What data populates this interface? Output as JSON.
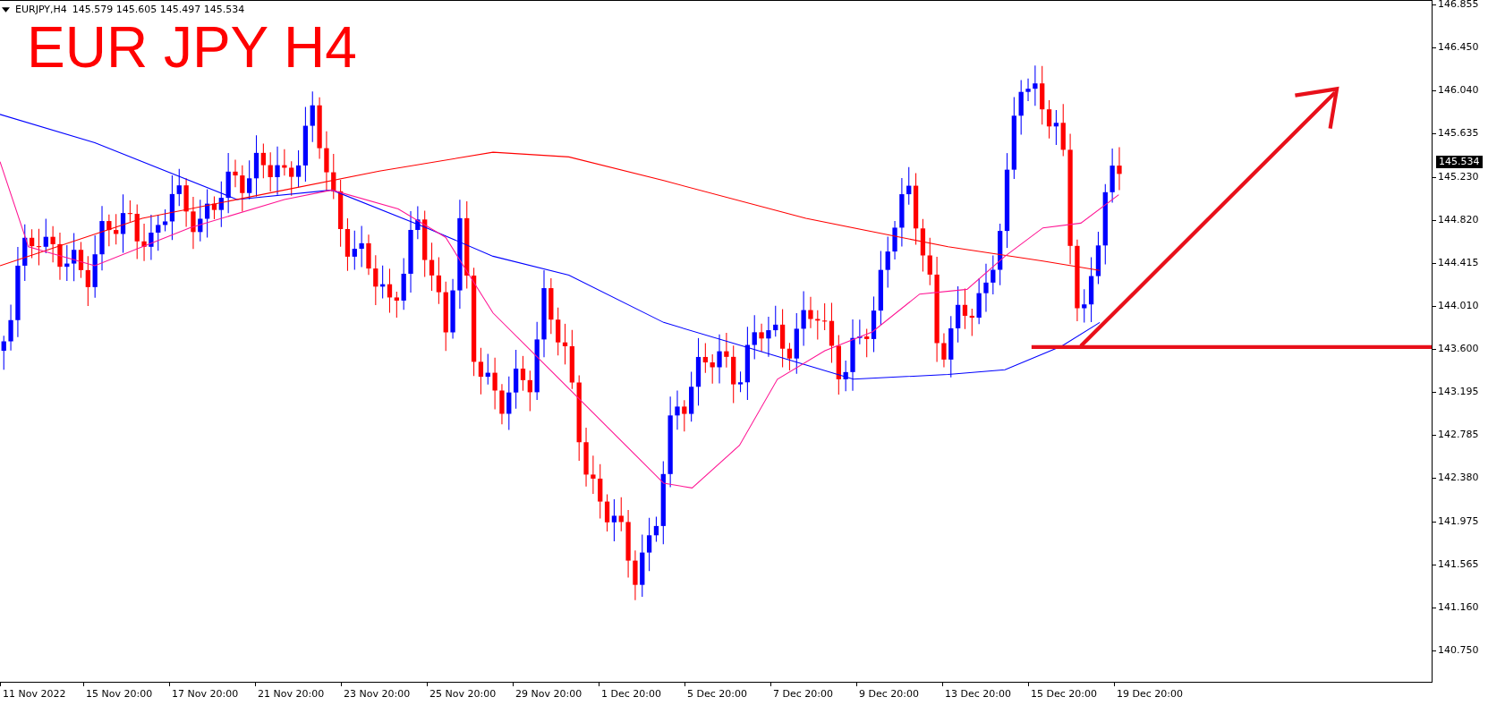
{
  "header": {
    "symbol": "EURJPY,H4",
    "ohlc": "145.579 145.605 145.497 145.534"
  },
  "title": "EUR JPY H4",
  "price_axis": [
    "146.855",
    "146.450",
    "146.040",
    "145.635",
    "145.230",
    "144.820",
    "144.415",
    "144.010",
    "143.600",
    "143.195",
    "142.785",
    "142.380",
    "141.975",
    "141.565",
    "141.160",
    "140.750"
  ],
  "current_price": "145.534",
  "time_axis": [
    "11 Nov 2022",
    "15 Nov 20:00",
    "17 Nov 20:00",
    "21 Nov 20:00",
    "23 Nov 20:00",
    "25 Nov 20:00",
    "29 Nov 20:00",
    "1 Dec 20:00",
    "5 Dec 20:00",
    "7 Dec 20:00",
    "9 Dec 20:00",
    "13 Dec 20:00",
    "15 Dec 20:00",
    "19 Dec 20:00"
  ]
}
